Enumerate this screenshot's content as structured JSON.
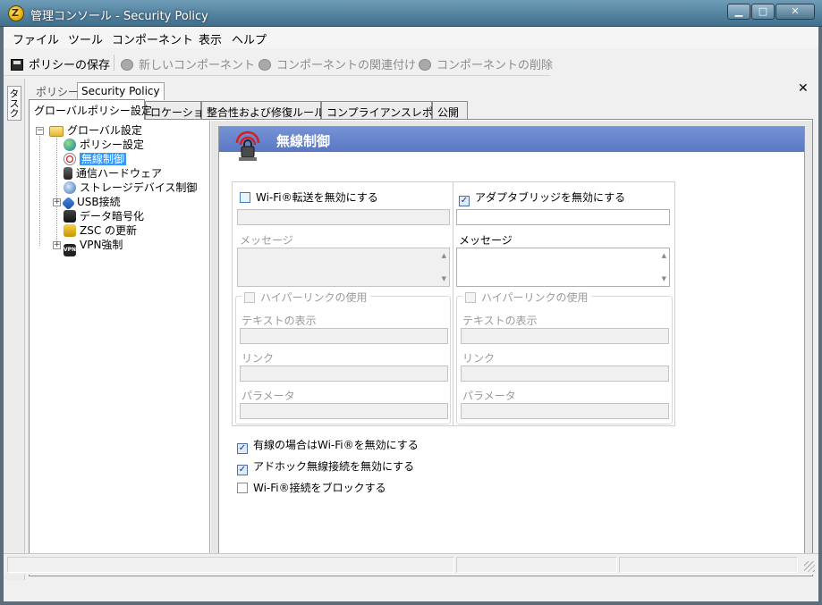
{
  "window": {
    "title": "管理コンソール - Security Policy",
    "app_icon_glyph": "Z",
    "controls": {
      "minimize": "▁",
      "maximize": "□",
      "close": "✕"
    }
  },
  "menu": [
    "ファイル",
    "ツール",
    "コンポーネント",
    "表示",
    "ヘルプ"
  ],
  "toolbar": {
    "save_label": "ポリシーの保存",
    "new_component_label": "新しいコンポーネント",
    "associate_label": "コンポーネントの関連付け",
    "delete_label": "コンポーネントの削除"
  },
  "task_panel": {
    "label": "タスク"
  },
  "policy": {
    "label": "ポリシー",
    "name": "Security Policy",
    "close_glyph": "✕"
  },
  "tabs": [
    "グローバルポリシー設定",
    "ロケーション",
    "整合性および修復ルール",
    "コンプライアンスレポート",
    "公開"
  ],
  "tree": {
    "root_label": "グローバル設定",
    "expander_open": "−",
    "expander_closed": "+",
    "items": [
      {
        "label": "ポリシー設定",
        "icon": "globe-icon"
      },
      {
        "label": "無線制御",
        "icon": "wireless-icon",
        "selected": true
      },
      {
        "label": "通信ハードウェア",
        "icon": "hardware-icon"
      },
      {
        "label": "ストレージデバイス制御",
        "icon": "storage-icon"
      },
      {
        "label": "USB接続",
        "icon": "usb-icon",
        "expandable": true
      },
      {
        "label": "データ暗号化",
        "icon": "encryption-icon"
      },
      {
        "label": "ZSC の更新",
        "icon": "update-icon"
      },
      {
        "label": "VPN強制",
        "icon": "vpn-icon",
        "expandable": true
      }
    ],
    "vpn_icon_text": "VPN"
  },
  "panel": {
    "title": "無線制御",
    "left_group": {
      "checkbox_label": "Wi-Fi®転送を無効にする",
      "checked": false,
      "message_label": "メッセージ",
      "hyperlink_label": "ハイパーリンクの使用",
      "display_text_label": "テキストの表示",
      "link_label": "リンク",
      "parameter_label": "パラメータ"
    },
    "right_group": {
      "checkbox_label": "アダプタブリッジを無効にする",
      "checked": true,
      "message_label": "メッセージ",
      "hyperlink_label": "ハイパーリンクの使用",
      "display_text_label": "テキストの表示",
      "link_label": "リンク",
      "parameter_label": "パラメータ"
    },
    "options": [
      {
        "label": "有線の場合はWi-Fi®を無効にする",
        "checked": true
      },
      {
        "label": "アドホック無線接続を無効にする",
        "checked": true
      },
      {
        "label": "Wi-Fi®接続をブロックする",
        "checked": false
      }
    ],
    "check_glyph": "✓",
    "scroll_up_glyph": "▲",
    "scroll_down_glyph": "▼"
  },
  "colors": {
    "title_bar": "#5b8aa6",
    "header_band": "#6785cc",
    "selection": "#3399ff"
  }
}
